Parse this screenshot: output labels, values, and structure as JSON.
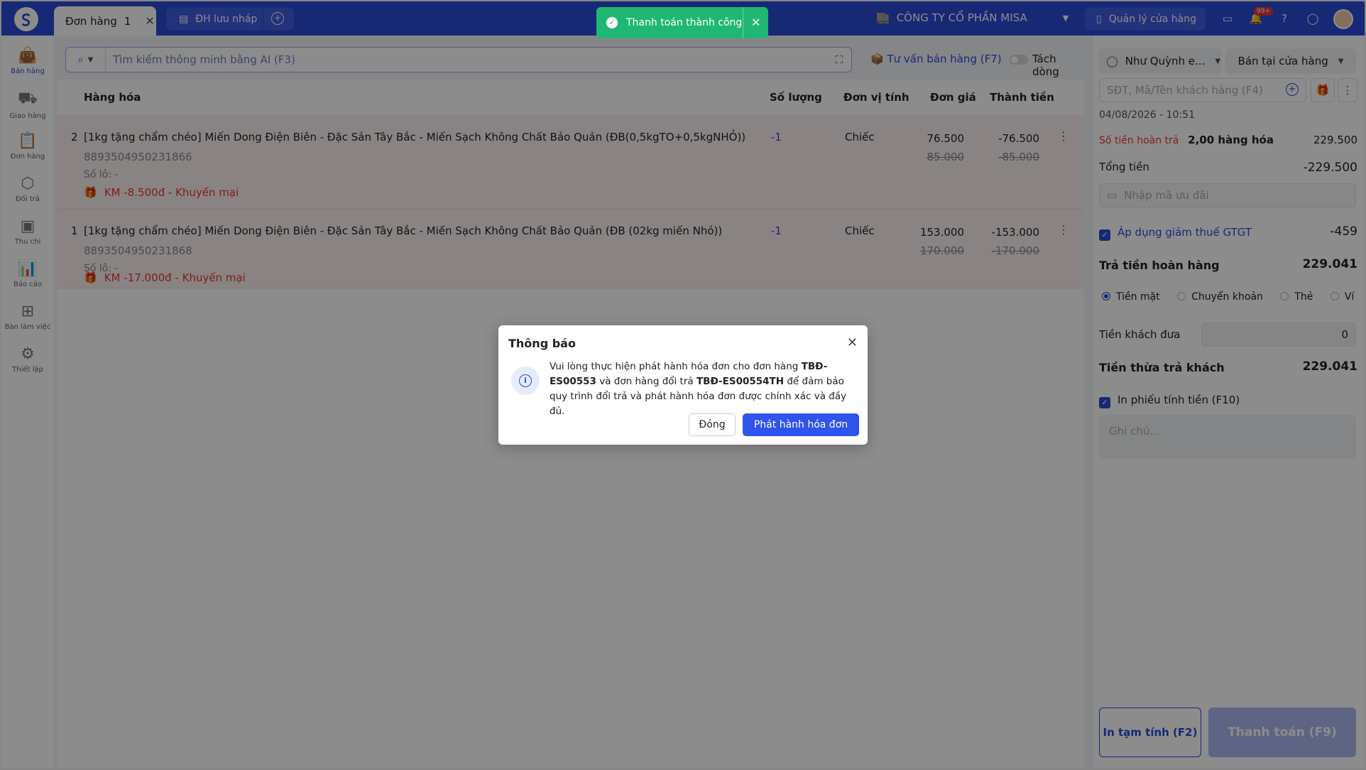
{
  "topbar": {
    "tab_active_label": "Đơn hàng",
    "tab_active_count": "1",
    "tab_draft_label": "ĐH lưu nháp",
    "company": "CÔNG TY CỔ PHẦN MISA",
    "store_button": "Quản lý cửa hàng",
    "notification_badge": "99+"
  },
  "toast": {
    "message": "Thanh toán thành công"
  },
  "sidebar": {
    "items": [
      {
        "label": "Bán hàng",
        "icon": "bag-icon"
      },
      {
        "label": "Giao hàng",
        "icon": "truck-icon"
      },
      {
        "label": "Đơn hàng",
        "icon": "clipboard-icon"
      },
      {
        "label": "Đổi trả",
        "icon": "box-return-icon"
      },
      {
        "label": "Thu chi",
        "icon": "wallet-icon"
      },
      {
        "label": "Báo cáo",
        "icon": "chart-icon"
      },
      {
        "label": "Bàn làm việc",
        "icon": "grid-icon"
      },
      {
        "label": "Thiết lập",
        "icon": "gear-icon"
      }
    ]
  },
  "search": {
    "placeholder": "Tìm kiếm thông minh bằng AI (F3)",
    "advise": "Tư vấn bán hàng (F7)",
    "split_line": "Tách dòng"
  },
  "table": {
    "headers": [
      "Hàng hóa",
      "Số lượng",
      "Đơn vị tính",
      "Đơn giá",
      "Thành tiền"
    ],
    "rows": [
      {
        "index": "2",
        "name": "[1kg tặng chẩm chéo] Miến Dong Điện Biên - Đặc Sản Tây Bắc - Miến Sạch Không Chất Bảo Quản (ĐB(0,5kgTO+0,5kgNHỎ))",
        "code": "8893504950231866",
        "lot": "Số lô: -",
        "promo": "KM -8.500đ - Khuyến mại",
        "qty": "-1",
        "unit": "Chiếc",
        "price": "76.500",
        "price_old": "85.000",
        "total": "-76.500",
        "total_old": "-85.000"
      },
      {
        "index": "1",
        "name": "[1kg tặng chẩm chéo] Miến Dong Điện Biên - Đặc Sản Tây Bắc - Miến Sạch Không Chất Bảo Quản (ĐB (02kg miến Nhỏ))",
        "code": "8893504950231868",
        "lot": "Số lô: -",
        "promo": "KM -17.000đ - Khuyến mại",
        "qty": "-1",
        "unit": "Chiếc",
        "price": "153.000",
        "price_old": "170.000",
        "total": "-153.000",
        "total_old": "-170.000"
      }
    ]
  },
  "panel": {
    "staff": "Như Quỳnh e...",
    "channel": "Bán tại cửa hàng",
    "customer_placeholder": "SĐT, Mã/Tên khách hàng (F4)",
    "datetime": "04/08/2026 - 10:51",
    "refund_label": "Số tiền hoàn trả",
    "refund_items": "2,00 hàng hóa",
    "refund_value": "229.500",
    "total_label": "Tổng tiền",
    "total_value": "-229.500",
    "voucher_placeholder": "Nhập mã ưu đãi",
    "vat_label": "Áp dụng giảm thuế GTGT",
    "vat_value": "-459",
    "return_pay_label": "Trả tiền hoàn hàng",
    "return_pay_value": "229.041",
    "pay_methods": [
      "Tiền mặt",
      "Chuyển khoản",
      "Thẻ",
      "Ví"
    ],
    "customer_pay_label": "Tiền khách đưa",
    "customer_pay_value": "0",
    "change_label": "Tiền thừa trả khách",
    "change_value": "229.041",
    "print_label": "In phiếu tính tiền (F10)",
    "note_placeholder": "Ghi chú...",
    "btn_print": "In tạm tính (F2)",
    "btn_pay": "Thanh toán (F9)"
  },
  "dialog": {
    "title": "Thông báo",
    "msg_part1": "Vui lòng thực hiện phát hành hóa đơn cho đơn hàng ",
    "order_code": "TBĐ-ES00553",
    "msg_part2": " và đơn hàng đổi trả ",
    "return_code": "TBĐ-ES00554TH",
    "msg_part3": " để đảm bảo quy trình đổi trả và phát hành hóa đơn được chính xác và đầy đủ.",
    "btn_close": "Đóng",
    "btn_issue": "Phát hành hóa đơn"
  }
}
